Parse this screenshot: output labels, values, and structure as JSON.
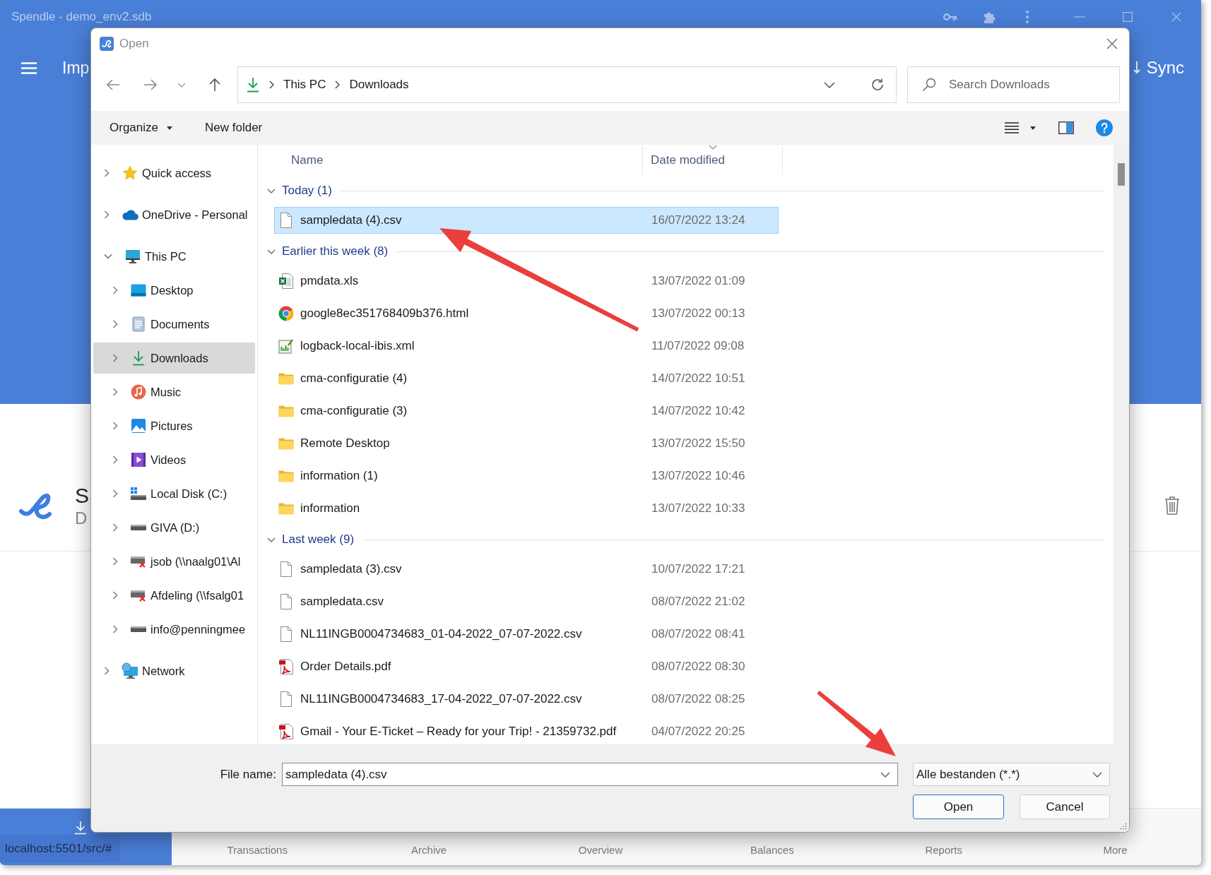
{
  "app_window": {
    "title": "Spendle - demo_env2.sdb",
    "header_title": "Imp",
    "sync_label": "Sync",
    "page_title": "S",
    "page_subtitle": "D",
    "status_url": "localhost:5501/src/#",
    "bottom_nav": [
      {
        "selected": true
      },
      {
        "label": "Transactions",
        "selected": false
      },
      {
        "label": "Archive",
        "selected": false
      },
      {
        "label": "Overview",
        "selected": false
      },
      {
        "label": "Balances",
        "selected": false
      },
      {
        "label": "Reports",
        "selected": false
      },
      {
        "label": "More",
        "selected": false
      }
    ]
  },
  "dialog": {
    "title": "Open",
    "address": [
      "This PC",
      "Downloads"
    ],
    "search": {
      "placeholder": "Search Downloads"
    },
    "toolbar": {
      "organize": "Organize",
      "new_folder": "New folder"
    },
    "nav_pane": [
      {
        "label": "Quick access",
        "kind": "star",
        "expanded": false,
        "selected": false
      },
      {
        "label": "OneDrive - Personal",
        "kind": "cloud",
        "expanded": false,
        "selected": false
      },
      {
        "label": "This PC",
        "kind": "pc",
        "expanded": true,
        "selected": false,
        "children": [
          {
            "label": "Desktop",
            "kind": "desktop",
            "expanded": false,
            "selected": false
          },
          {
            "label": "Documents",
            "kind": "documents",
            "expanded": false,
            "selected": false
          },
          {
            "label": "Downloads",
            "kind": "downloads",
            "expanded": false,
            "selected": true
          },
          {
            "label": "Music",
            "kind": "music",
            "expanded": false,
            "selected": false
          },
          {
            "label": "Pictures",
            "kind": "pictures",
            "expanded": false,
            "selected": false
          },
          {
            "label": "Videos",
            "kind": "videos",
            "expanded": false,
            "selected": false
          },
          {
            "label": "Local Disk (C:)",
            "kind": "disk",
            "expanded": false,
            "selected": false
          },
          {
            "label": "GIVA (D:)",
            "kind": "drive",
            "expanded": false,
            "selected": false
          },
          {
            "label": "jsob (\\\\naalg01\\Al",
            "kind": "network-drive",
            "expanded": false,
            "selected": false
          },
          {
            "label": "Afdeling (\\\\fsalg01",
            "kind": "network-drive",
            "expanded": false,
            "selected": false
          },
          {
            "label": "info@penningmee",
            "kind": "drive",
            "expanded": false,
            "selected": false
          }
        ]
      },
      {
        "label": "Network",
        "kind": "network",
        "expanded": false,
        "selected": false
      }
    ],
    "columns": [
      {
        "label": "Name",
        "sorted": false
      },
      {
        "label": "Date modified",
        "sorted": true
      }
    ],
    "groups": [
      {
        "label": "Today (1)",
        "expanded": true,
        "files": [
          {
            "name": "sampledata (4).csv",
            "kind": "file",
            "date": "16/07/2022 13:24",
            "selected": true
          }
        ]
      },
      {
        "label": "Earlier this week (8)",
        "expanded": true,
        "files": [
          {
            "name": "pmdata.xls",
            "kind": "excel",
            "date": "13/07/2022 01:09",
            "selected": false
          },
          {
            "name": "google8ec351768409b376.html",
            "kind": "web",
            "date": "13/07/2022 00:13",
            "selected": false
          },
          {
            "name": "logback-local-ibis.xml",
            "kind": "xml",
            "date": "11/07/2022 09:08",
            "selected": false
          },
          {
            "name": "cma-configuratie (4)",
            "kind": "folder",
            "date": "14/07/2022 10:51",
            "selected": false
          },
          {
            "name": "cma-configuratie (3)",
            "kind": "folder",
            "date": "14/07/2022 10:42",
            "selected": false
          },
          {
            "name": "Remote Desktop",
            "kind": "folder",
            "date": "13/07/2022 15:50",
            "selected": false
          },
          {
            "name": "information (1)",
            "kind": "folder",
            "date": "13/07/2022 10:46",
            "selected": false
          },
          {
            "name": "information",
            "kind": "folder",
            "date": "13/07/2022 10:33",
            "selected": false
          }
        ]
      },
      {
        "label": "Last week (9)",
        "expanded": true,
        "files": [
          {
            "name": "sampledata (3).csv",
            "kind": "file",
            "date": "10/07/2022 17:21",
            "selected": false
          },
          {
            "name": "sampledata.csv",
            "kind": "file",
            "date": "08/07/2022 21:02",
            "selected": false
          },
          {
            "name": "NL11INGB0004734683_01-04-2022_07-07-2022.csv",
            "kind": "file",
            "date": "08/07/2022 08:41",
            "selected": false
          },
          {
            "name": "Order Details.pdf",
            "kind": "pdf",
            "date": "08/07/2022 08:30",
            "selected": false
          },
          {
            "name": "NL11INGB0004734683_17-04-2022_07-07-2022.csv",
            "kind": "file",
            "date": "08/07/2022 08:25",
            "selected": false
          },
          {
            "name": "Gmail - Your E-Ticket – Ready for your Trip! - 21359732.pdf",
            "kind": "pdf",
            "date": "04/07/2022 20:25",
            "selected": false
          }
        ]
      }
    ],
    "file_name": {
      "label": "File name:",
      "value": "sampledata (4).csv"
    },
    "file_type": {
      "value": "Alle bestanden (*.*)"
    },
    "buttons": [
      {
        "label": "Open",
        "kind": "primary"
      },
      {
        "label": "Cancel",
        "kind": "secondary"
      }
    ]
  },
  "annotations": [
    {
      "kind": "arrow"
    },
    {
      "kind": "arrow"
    }
  ]
}
